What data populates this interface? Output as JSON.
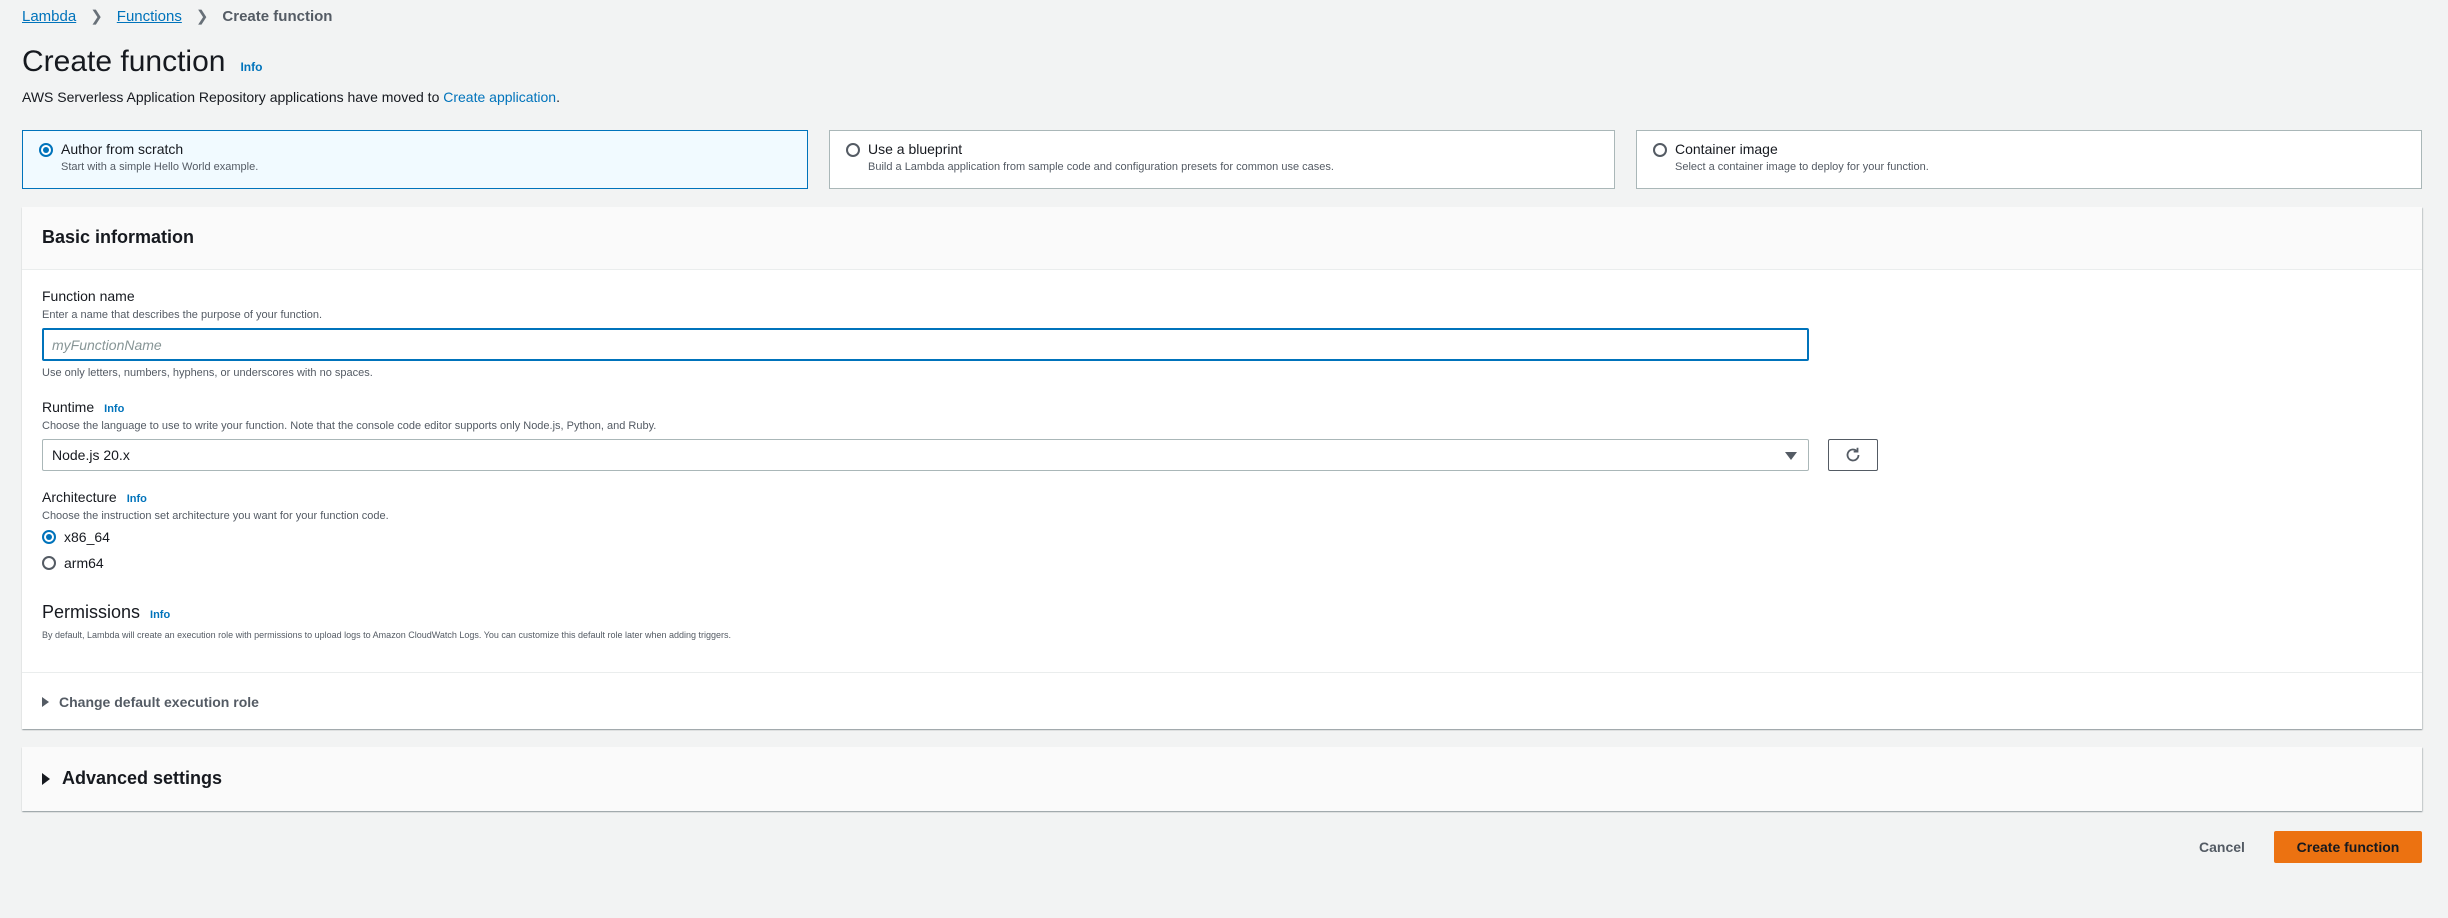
{
  "breadcrumb": {
    "items": [
      "Lambda",
      "Functions"
    ],
    "current": "Create function"
  },
  "header": {
    "title": "Create function",
    "info": "Info",
    "notice_prefix": "AWS Serverless Application Repository applications have moved to ",
    "notice_link": "Create application",
    "notice_suffix": "."
  },
  "options": [
    {
      "label": "Author from scratch",
      "description": "Start with a simple Hello World example.",
      "selected": true
    },
    {
      "label": "Use a blueprint",
      "description": "Build a Lambda application from sample code and configuration presets for common use cases.",
      "selected": false
    },
    {
      "label": "Container image",
      "description": "Select a container image to deploy for your function.",
      "selected": false
    }
  ],
  "basic_info": {
    "title": "Basic information",
    "function_name": {
      "label": "Function name",
      "description": "Enter a name that describes the purpose of your function.",
      "placeholder": "myFunctionName",
      "value": "",
      "constraint": "Use only letters, numbers, hyphens, or underscores with no spaces."
    },
    "runtime": {
      "label": "Runtime",
      "info": "Info",
      "description": "Choose the language to use to write your function. Note that the console code editor supports only Node.js, Python, and Ruby.",
      "value": "Node.js 20.x"
    },
    "architecture": {
      "label": "Architecture",
      "info": "Info",
      "description": "Choose the instruction set architecture you want for your function code.",
      "options": [
        {
          "label": "x86_64",
          "selected": true
        },
        {
          "label": "arm64",
          "selected": false
        }
      ]
    },
    "permissions": {
      "title": "Permissions",
      "info": "Info",
      "description": "By default, Lambda will create an execution role with permissions to upload logs to Amazon CloudWatch Logs. You can customize this default role later when adding triggers."
    },
    "change_role": "Change default execution role"
  },
  "advanced": {
    "title": "Advanced settings"
  },
  "footer": {
    "cancel": "Cancel",
    "create": "Create function"
  },
  "colors": {
    "accent": "#0073bb",
    "primary_button": "#ec7211",
    "background": "#f2f3f3"
  }
}
